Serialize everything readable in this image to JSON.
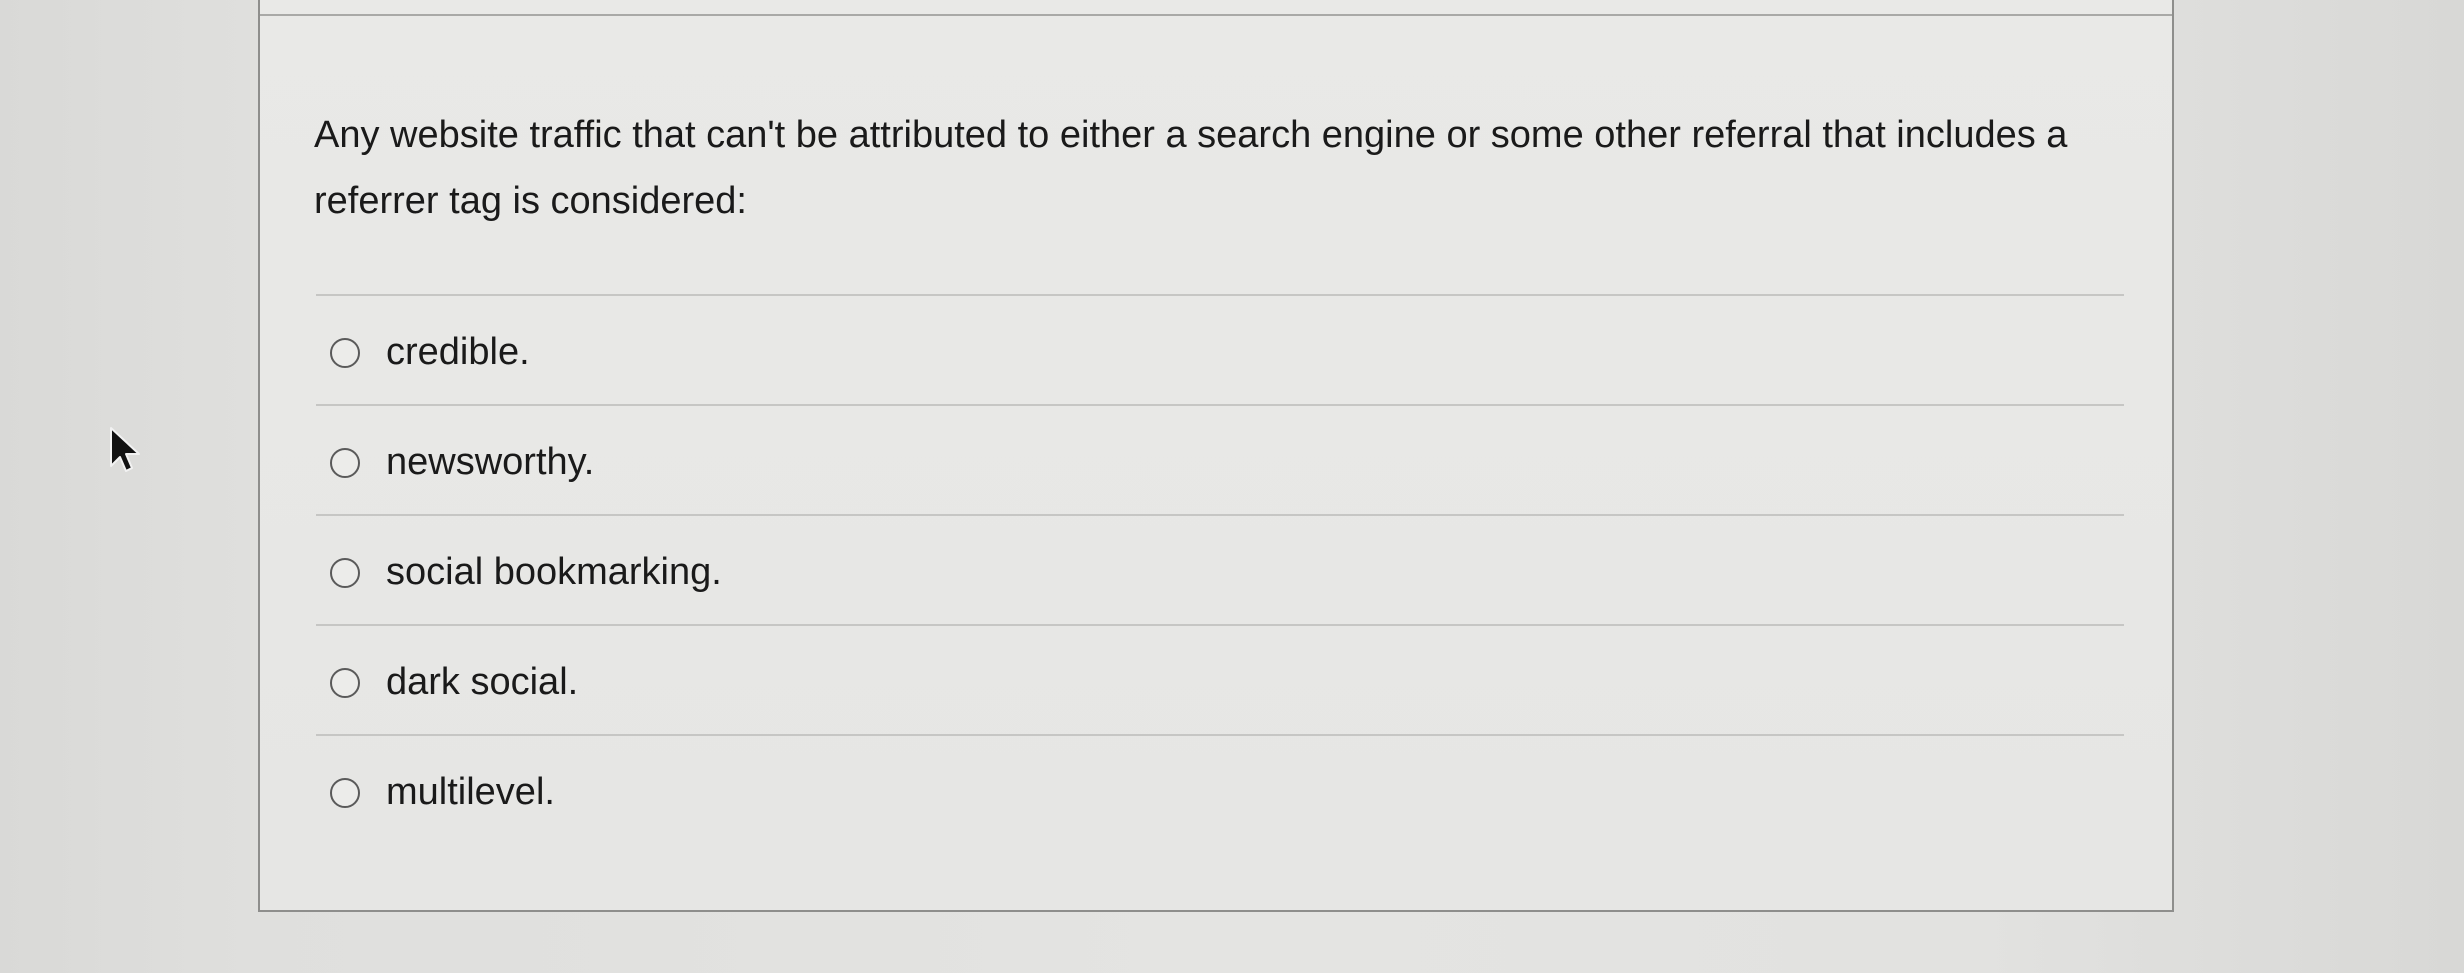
{
  "question": {
    "text": "Any website traffic that can't be attributed to either a search engine or some other referral that includes a referrer tag is considered:"
  },
  "options": [
    {
      "label": "credible."
    },
    {
      "label": "newsworthy."
    },
    {
      "label": "social bookmarking."
    },
    {
      "label": "dark social."
    },
    {
      "label": "multilevel."
    }
  ],
  "icons": {
    "cursor": "mouse-pointer-icon",
    "radio": "radio-unselected-icon"
  },
  "colors": {
    "background": "#e2e2e0",
    "card_border": "#8e8e8c",
    "divider": "#c6c6c4",
    "text": "#1a1a1a"
  }
}
